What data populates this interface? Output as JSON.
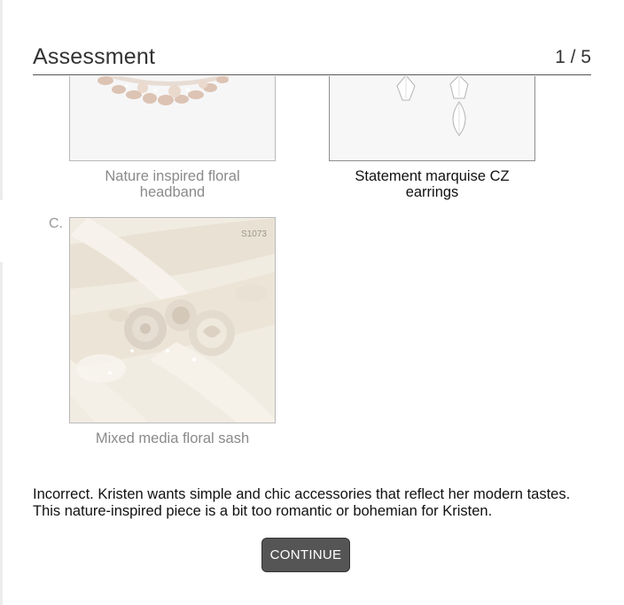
{
  "header": {
    "title": "Assessment",
    "progress": "1 / 5"
  },
  "options": [
    {
      "caption": "Nature inspired floral headband"
    },
    {
      "caption": "Statement marquise CZ earrings"
    },
    {
      "letter": "C.",
      "caption": "Mixed media floral sash",
      "product_code": "S1073"
    }
  ],
  "feedback": "Incorrect. Kristen wants simple and chic accessories that reflect her modern tastes. This nature-inspired piece is a bit too romantic or bohemian for Kristen.",
  "continue_label": "CONTINUE"
}
